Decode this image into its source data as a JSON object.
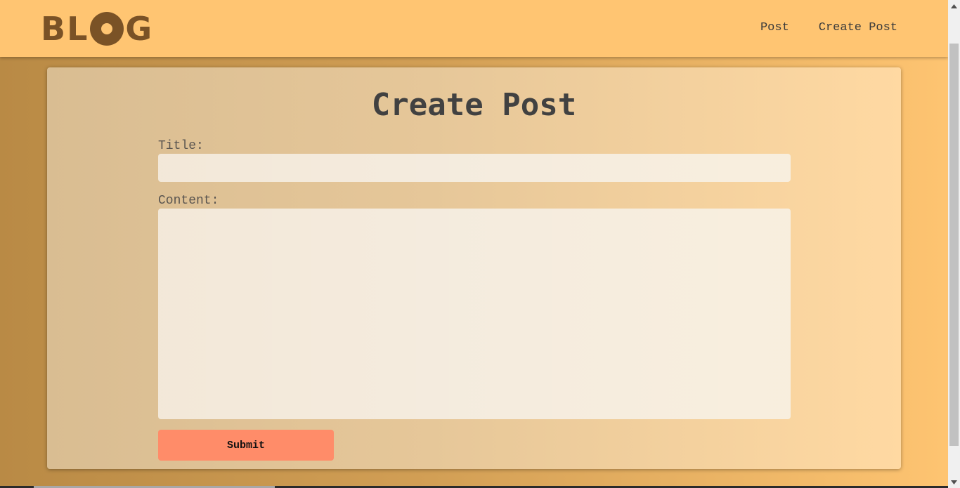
{
  "header": {
    "logo_letters": [
      "B",
      "L",
      "O",
      "G"
    ],
    "nav": [
      {
        "label": "Post"
      },
      {
        "label": "Create Post"
      }
    ]
  },
  "form": {
    "heading": "Create Post",
    "title_label": "Title:",
    "title_value": "",
    "content_label": "Content:",
    "content_value": "",
    "submit_label": "Submit"
  },
  "colors": {
    "header_bg": "#ffc572",
    "logo": "#7a5226",
    "submit_bg": "#ff8c69",
    "heading_text": "#414141"
  },
  "icons": {
    "logo_o": "ring-icon",
    "scroll_up": "triangle-up-icon",
    "scroll_down": "triangle-down-icon"
  }
}
